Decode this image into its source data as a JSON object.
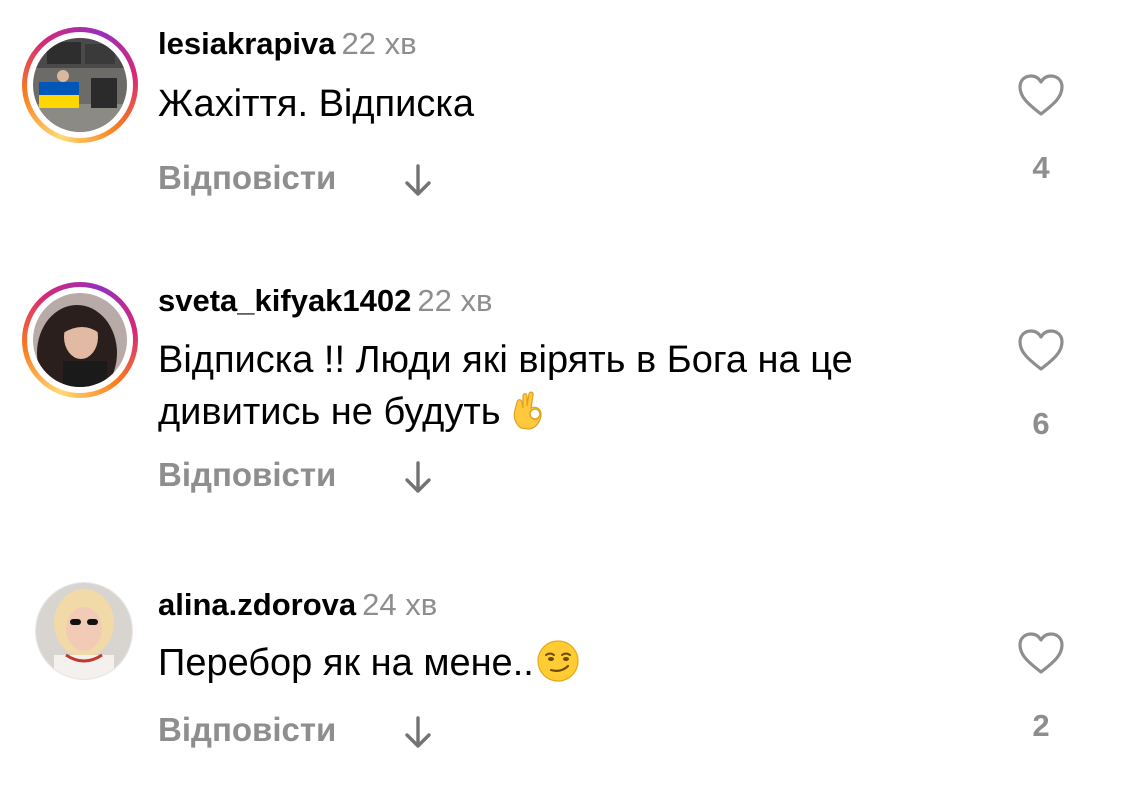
{
  "reply_label": "Відповісти",
  "colors": {
    "username": "#000000",
    "secondary_text": "#8e8e8e",
    "story_ring": [
      "#feda75",
      "#fa7e1e",
      "#d62976",
      "#962fbf"
    ]
  },
  "icons": {
    "like": "heart-outline-icon",
    "replies": "arrow-down-icon"
  },
  "comments": [
    {
      "username": "lesiakrapiva",
      "time": "22 хв",
      "text": "Жахіття. Відписка",
      "likes": "4",
      "has_story_ring": true
    },
    {
      "username": "sveta_kifyak1402",
      "time": "22 хв",
      "text_line1": "Відписка !! Люди які вірять в Бога на це",
      "text_line2": "дивитись не будуть",
      "emoji": "👌",
      "likes": "6",
      "has_story_ring": true
    },
    {
      "username": "alina.zdorova",
      "time": "24 хв",
      "text": "Перебор як на мене..",
      "emoji": "😏",
      "likes": "2",
      "has_story_ring": false
    }
  ]
}
